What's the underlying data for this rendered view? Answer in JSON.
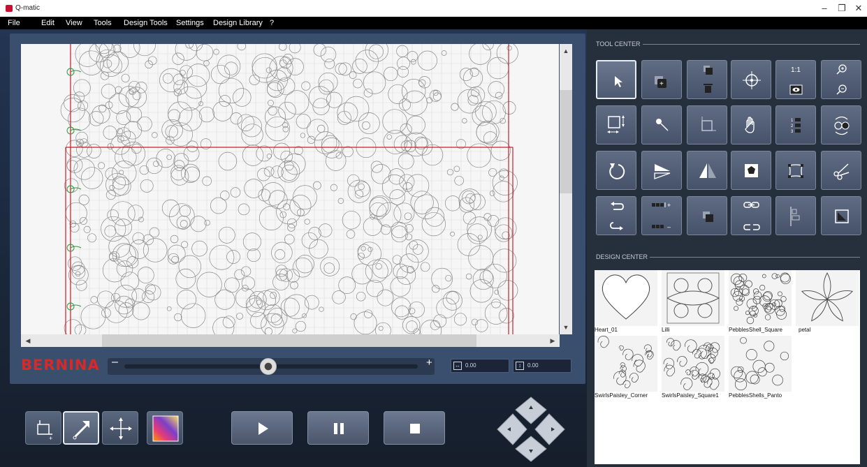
{
  "window": {
    "title": "Q-matic",
    "controls": [
      "–",
      "❐",
      "✕"
    ]
  },
  "menu": [
    "File",
    "Edit",
    "View",
    "Tools",
    "Design Tools",
    "Settings",
    "Design Library",
    "?"
  ],
  "brand": "BERNINA",
  "zoom": {
    "minus": "–",
    "plus": "+",
    "level": 0.49
  },
  "coords": {
    "x_value": "0.00",
    "y_value": "0.00"
  },
  "bottom_toolbar": {
    "modes": [
      {
        "name": "crop-add-icon",
        "active": false
      },
      {
        "name": "stitch-path-icon",
        "active": true
      },
      {
        "name": "move-arrows-icon",
        "active": false
      },
      {
        "name": "color-fill-icon",
        "active": false
      }
    ],
    "controls": [
      {
        "name": "play-icon",
        "label": "Play"
      },
      {
        "name": "pause-icon",
        "label": "Pause"
      },
      {
        "name": "stop-icon",
        "label": "Stop"
      }
    ]
  },
  "tool_center": {
    "label": "TOOL CENTER",
    "zoom_1to1": "1:1"
  },
  "design_center": {
    "label": "DESIGN CENTER",
    "designs": [
      {
        "name": "Heart_01"
      },
      {
        "name": "Lilli"
      },
      {
        "name": "PebblesShell_Square"
      },
      {
        "name": "petal"
      },
      {
        "name": "SwirlsPaisley_Corner"
      },
      {
        "name": "SwirlsPaisley_Square1"
      },
      {
        "name": "PebblesShells_Panto"
      }
    ]
  },
  "colors": {
    "accent_red": "#d62a2a",
    "panel_blue": "#3a4f6e",
    "tool_button": "#56627a"
  }
}
